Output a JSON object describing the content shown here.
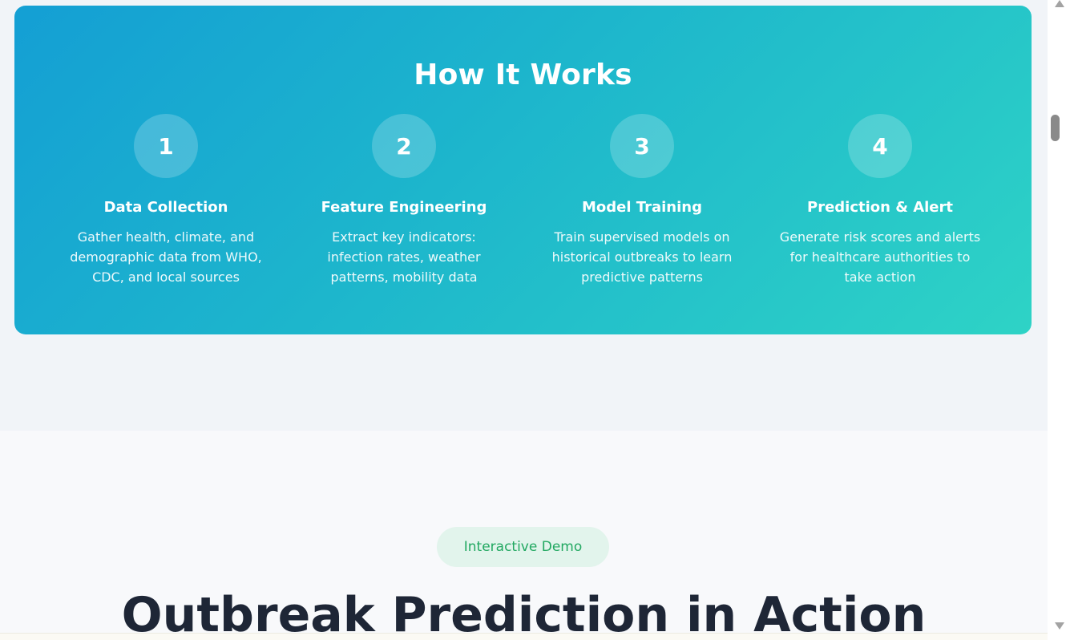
{
  "how_it_works": {
    "title": "How It Works",
    "steps": [
      {
        "number": "1",
        "title": "Data Collection",
        "description": "Gather health, climate, and demographic data from WHO, CDC, and local sources"
      },
      {
        "number": "2",
        "title": "Feature Engineering",
        "description": "Extract key indicators: infection rates, weather patterns, mobility data"
      },
      {
        "number": "3",
        "title": "Model Training",
        "description": "Train supervised models on historical outbreaks to learn predictive patterns"
      },
      {
        "number": "4",
        "title": "Prediction & Alert",
        "description": "Generate risk scores and alerts for healthcare authorities to take action"
      }
    ]
  },
  "demo": {
    "badge": "Interactive Demo",
    "title": "Outbreak Prediction in Action"
  },
  "colors": {
    "gradient_start": "#149fd4",
    "gradient_end": "#2ed3c6",
    "badge_text": "#22a861",
    "badge_bg": "#e2f4ec",
    "heading_dark": "#1e2636"
  },
  "icons": {
    "scroll_up": "triangle-up-icon",
    "scroll_down": "triangle-down-icon"
  }
}
